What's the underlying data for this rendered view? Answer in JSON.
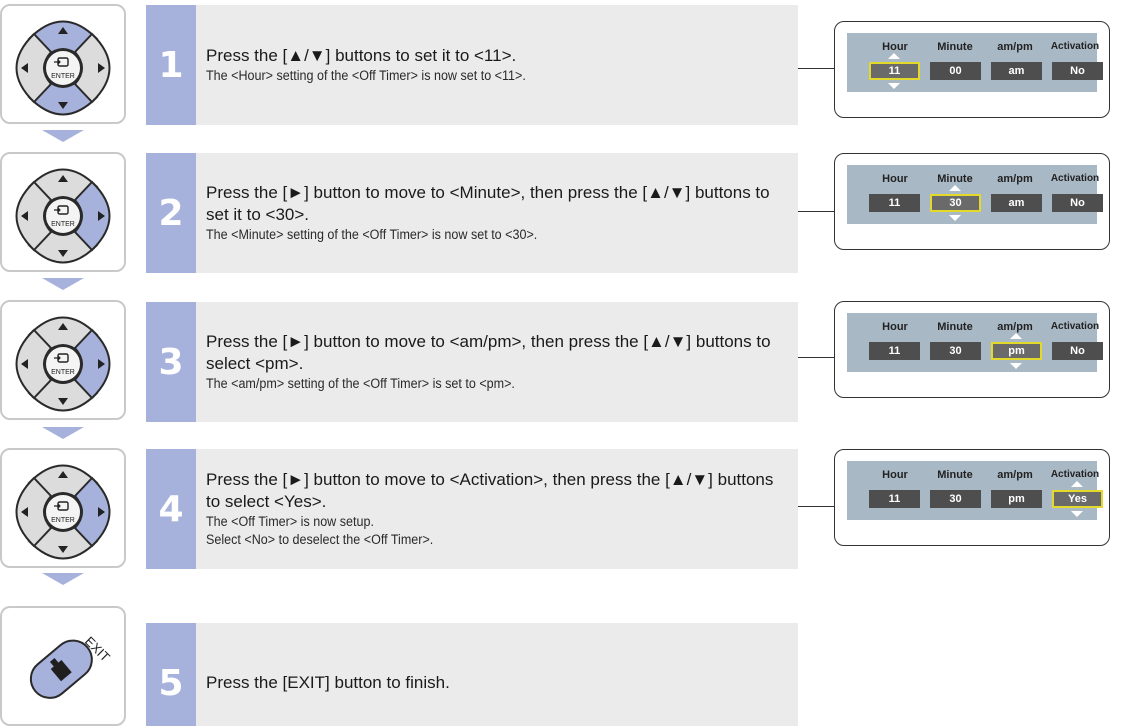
{
  "colors": {
    "accent": "#a7b2dc",
    "panel_bg": "#ebebeb",
    "osd_bg": "#a9b8c5",
    "osd_value_bg": "#4e4e4e",
    "highlight": "#e3d92a"
  },
  "remote": {
    "enter_label": "ENTER",
    "exit_label": "EXIT"
  },
  "steps": [
    {
      "number": "1",
      "main": "Press the [▲/▼] buttons to set it to <11>.",
      "sub": [
        "The <Hour> setting of the <Off Timer> is now set to <11>."
      ]
    },
    {
      "number": "2",
      "main": "Press the [►] button to move to <Minute>, then press the [▲/▼] buttons to set it to <30>.",
      "sub": [
        "The <Minute> setting of the <Off Timer> is now set to <30>."
      ]
    },
    {
      "number": "3",
      "main": "Press the [►] button to move to <am/pm>, then press the [▲/▼] buttons to select <pm>.",
      "sub": [
        "The <am/pm> setting of the <Off Timer> is set to <pm>."
      ]
    },
    {
      "number": "4",
      "main": "Press the [►] button to move to <Activation>, then press the [▲/▼] buttons to select <Yes>.",
      "sub": [
        "The <Off Timer> is now setup.",
        "Select <No> to deselect the <Off Timer>."
      ]
    },
    {
      "number": "5",
      "main": "Press the [EXIT] button to finish.",
      "sub": []
    }
  ],
  "osd": {
    "headers": [
      "Hour",
      "Minute",
      "am/pm",
      "Activation"
    ],
    "screens": [
      {
        "values": [
          "11",
          "00",
          "am",
          "No"
        ],
        "selected": 0
      },
      {
        "values": [
          "11",
          "30",
          "am",
          "No"
        ],
        "selected": 1
      },
      {
        "values": [
          "11",
          "30",
          "pm",
          "No"
        ],
        "selected": 2
      },
      {
        "values": [
          "11",
          "30",
          "pm",
          "Yes"
        ],
        "selected": 3
      }
    ]
  }
}
